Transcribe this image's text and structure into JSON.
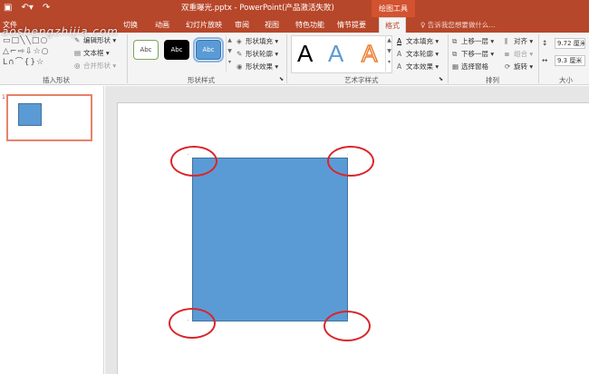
{
  "title_bar": {
    "qat": {
      "save_icon": "save-icon",
      "undo_icon": "undo-icon",
      "redo_icon": "redo-icon"
    },
    "document_title": "双重曝光.pptx - PowerPoint(产品激活失败)",
    "context_tool_label": "绘图工具"
  },
  "tabs": [
    {
      "label": "文件"
    },
    {
      "label": "切换"
    },
    {
      "label": "动画"
    },
    {
      "label": "幻灯片放映"
    },
    {
      "label": "审阅"
    },
    {
      "label": "视图"
    },
    {
      "label": "特色功能"
    },
    {
      "label": "情节提要"
    },
    {
      "label": "格式",
      "active": true
    }
  ],
  "tell_me": {
    "icon": "lightbulb-icon",
    "text": "告诉我您想要做什么..."
  },
  "ribbon": {
    "insert_shapes": {
      "group_label": "插入形状",
      "edit_shape": "编辑形状",
      "text_box": "文本框",
      "merge_shapes": "合并形状"
    },
    "shape_styles": {
      "group_label": "形状样式",
      "presets": [
        "Abc",
        "Abc",
        "Abc"
      ],
      "fill": "形状填充",
      "outline": "形状轮廓",
      "effects": "形状效果"
    },
    "wordart_styles": {
      "group_label": "艺术字样式",
      "letters": [
        "A",
        "A",
        "A"
      ],
      "text_fill": "文本填充",
      "text_outline": "文本轮廓",
      "text_effects": "文本效果"
    },
    "arrange": {
      "group_label": "排列",
      "bring_forward": "上移一层",
      "send_backward": "下移一层",
      "selection_pane": "选择窗格",
      "align": "对齐",
      "group": "组合",
      "rotate": "旋转"
    },
    "size": {
      "group_label": "大小",
      "height": "9.72 厘米",
      "width": "9.3 厘米"
    }
  },
  "slides_pane": {
    "slide_number": "1"
  },
  "watermark": "aoshengzhijia.com",
  "colors": {
    "accent": "#b7472a",
    "shape_fill": "#5b9bd5",
    "shape_border": "#41719c",
    "highlight": "#d9262a"
  }
}
